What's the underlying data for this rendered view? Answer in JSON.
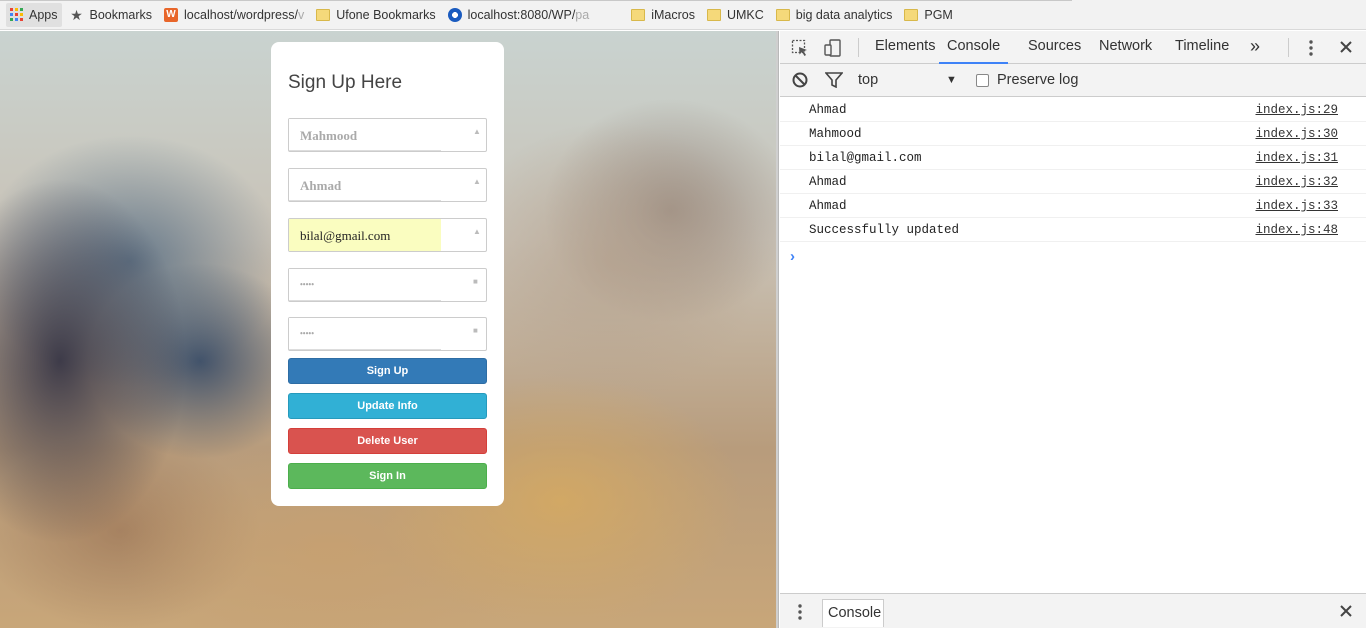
{
  "bookmarks": [
    {
      "label": "Apps",
      "icon": "apps-grid-icon"
    },
    {
      "label": "Bookmarks",
      "icon": "star-icon"
    },
    {
      "label": "localhost/wordpress/",
      "faded": "v",
      "icon": "wordpress-favicon"
    },
    {
      "label": "Ufone Bookmarks",
      "icon": "folder-icon"
    },
    {
      "label": "localhost:8080/WP/",
      "faded": "pa",
      "icon": "gear-favicon"
    },
    {
      "label": "",
      "icon": "page-icon"
    },
    {
      "label": "iMacros",
      "icon": "folder-icon"
    },
    {
      "label": "UMKC",
      "icon": "folder-icon"
    },
    {
      "label": "big data analytics",
      "icon": "folder-icon"
    },
    {
      "label": "PGM",
      "icon": "folder-icon"
    }
  ],
  "form": {
    "title": "Sign Up Here",
    "fields": [
      {
        "name": "last-name",
        "value": "Mahmood"
      },
      {
        "name": "first-name",
        "value": "Ahmad"
      },
      {
        "name": "email",
        "value": "bilal@gmail.com"
      },
      {
        "name": "password",
        "value": "•••••"
      },
      {
        "name": "confirm-password",
        "value": "•••••"
      }
    ],
    "buttons": {
      "signup": "Sign Up",
      "update": "Update Info",
      "delete": "Delete User",
      "signin": "Sign In"
    },
    "colors": {
      "primary": "#337ab7",
      "info": "#31b0d5",
      "danger": "#d9534f",
      "success": "#5cb85c",
      "autofill": "#fafdc0"
    }
  },
  "devtools": {
    "tabs": [
      "Elements",
      "Console",
      "Sources",
      "Network",
      "Timeline"
    ],
    "active_tab": "Console",
    "more": "»",
    "context": "top",
    "preserve_log": "Preserve log",
    "logs": [
      {
        "msg": "Ahmad",
        "src": "index.js:29"
      },
      {
        "msg": "Mahmood",
        "src": "index.js:30"
      },
      {
        "msg": "bilal@gmail.com",
        "src": "index.js:31"
      },
      {
        "msg": "Ahmad",
        "src": "index.js:32"
      },
      {
        "msg": "Ahmad",
        "src": "index.js:33"
      },
      {
        "msg": "Successfully updated",
        "src": "index.js:48"
      }
    ],
    "prompt": "›",
    "drawer_tab": "Console",
    "accent": "#3e82f7"
  }
}
